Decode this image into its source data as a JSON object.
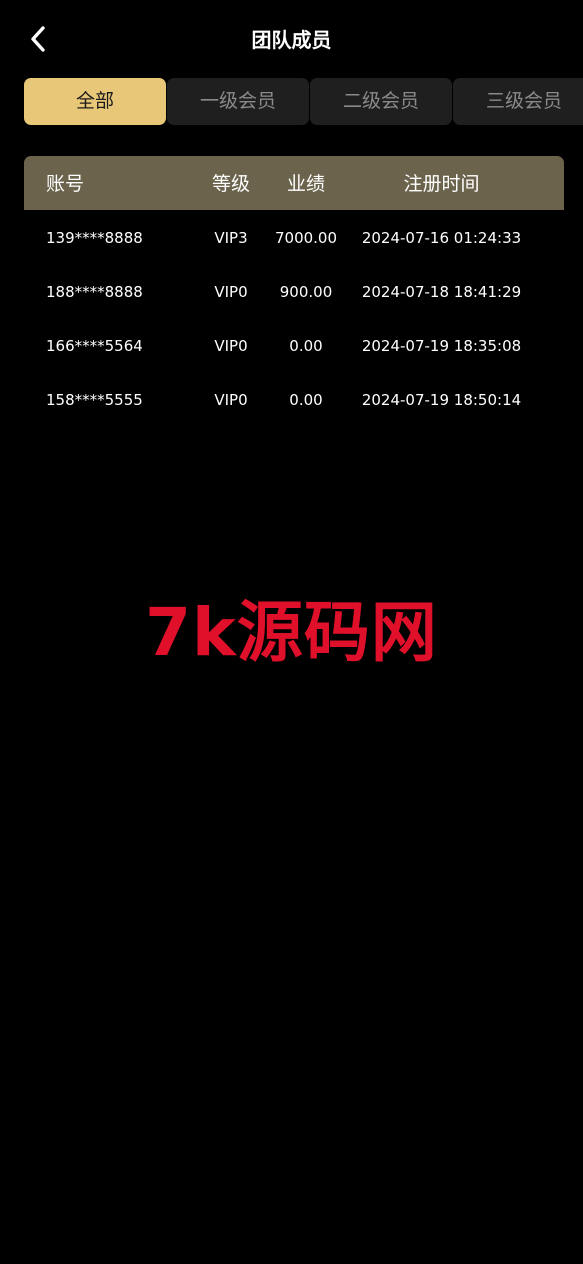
{
  "header": {
    "title": "团队成员",
    "back_icon": "chevron-left-icon"
  },
  "tabs": [
    {
      "label": "全部",
      "active": true
    },
    {
      "label": "一级会员",
      "active": false
    },
    {
      "label": "二级会员",
      "active": false
    },
    {
      "label": "三级会员",
      "active": false
    }
  ],
  "table": {
    "columns": [
      "账号",
      "等级",
      "业绩",
      "注册时间"
    ],
    "rows": [
      [
        "139****8888",
        "VIP3",
        "7000.00",
        "2024-07-16 01:24:33"
      ],
      [
        "188****8888",
        "VIP0",
        "900.00",
        "2024-07-18 18:41:29"
      ],
      [
        "166****5564",
        "VIP0",
        "0.00",
        "2024-07-19 18:35:08"
      ],
      [
        "158****5555",
        "VIP0",
        "0.00",
        "2024-07-19 18:50:14"
      ]
    ]
  },
  "watermark": {
    "text": "7k源码网",
    "color": "#e0102a"
  },
  "colors": {
    "background": "#000000",
    "tab_active": "#e8c878",
    "tab_inactive": "#1f1f1f",
    "table_header": "#6b634c"
  }
}
